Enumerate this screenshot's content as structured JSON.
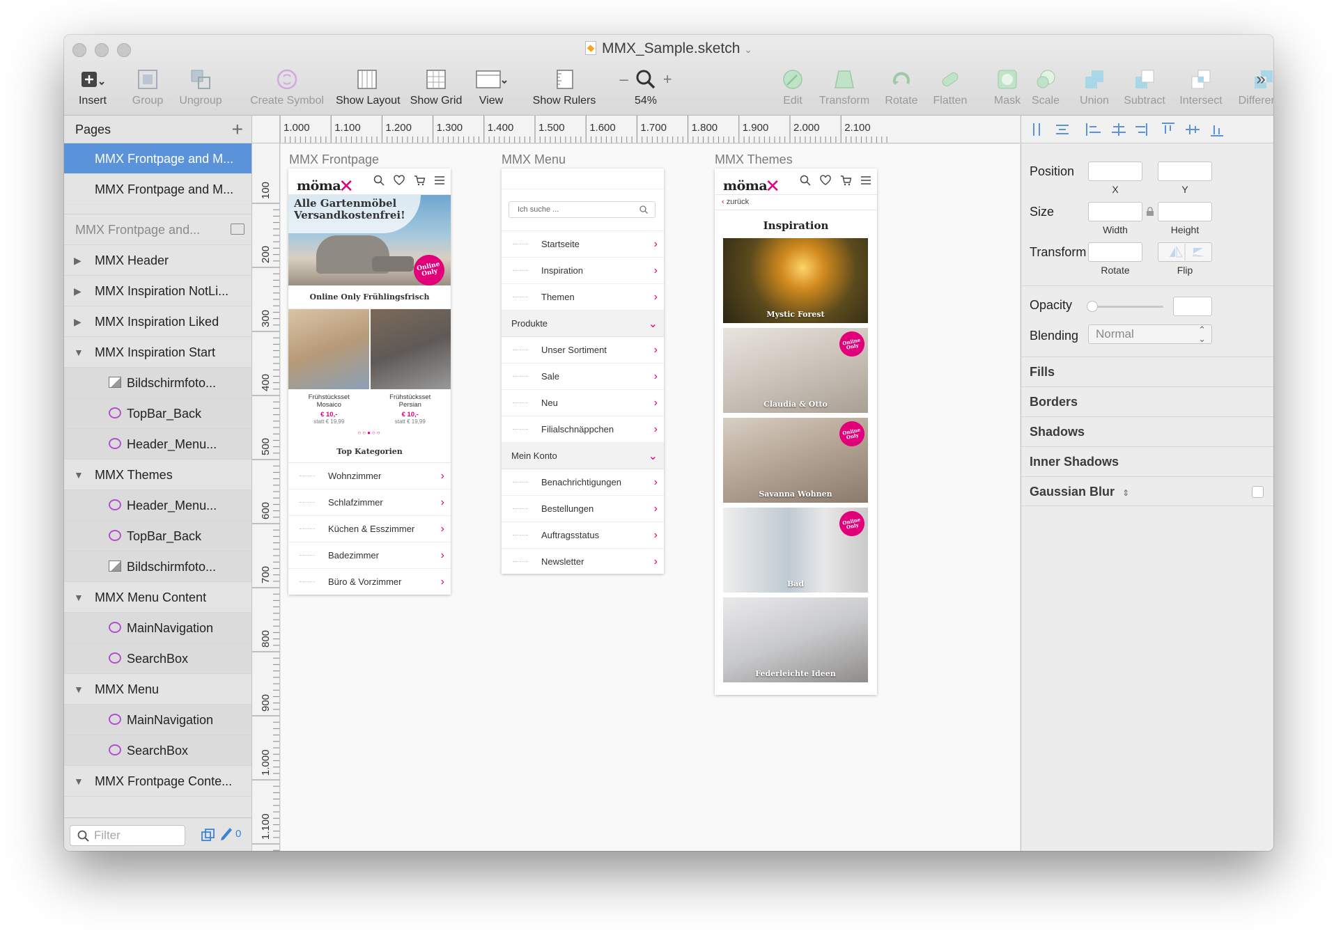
{
  "window": {
    "title": "MMX_Sample.sketch"
  },
  "toolbar": {
    "insert": "Insert",
    "group": "Group",
    "ungroup": "Ungroup",
    "create_symbol": "Create Symbol",
    "show_layout": "Show Layout",
    "show_grid": "Show Grid",
    "view": "View",
    "show_rulers": "Show Rulers",
    "zoom": "54%",
    "zoom_minus": "–",
    "zoom_plus": "+",
    "edit": "Edit",
    "transform": "Transform",
    "rotate": "Rotate",
    "flatten": "Flatten",
    "mask": "Mask",
    "scale": "Scale",
    "union": "Union",
    "subtract": "Subtract",
    "intersect": "Intersect",
    "difference": "Difference",
    "more": "»"
  },
  "sidebar": {
    "pages_title": "Pages",
    "pages": [
      "MMX Frontpage and M...",
      "MMX Frontpage and M..."
    ],
    "layers_title": "MMX Frontpage and...",
    "layers": [
      {
        "label": "MMX Header",
        "level": 0,
        "toggle": "closed"
      },
      {
        "label": "MMX Inspiration NotLi...",
        "level": 0,
        "toggle": "closed"
      },
      {
        "label": "MMX Inspiration Liked",
        "level": 0,
        "toggle": "closed"
      },
      {
        "label": "MMX Inspiration Start",
        "level": 0,
        "toggle": "open"
      },
      {
        "label": "Bildschirmfoto...",
        "level": 1,
        "icon": "image"
      },
      {
        "label": "TopBar_Back",
        "level": 1,
        "icon": "symbol"
      },
      {
        "label": "Header_Menu...",
        "level": 1,
        "icon": "symbol"
      },
      {
        "label": "MMX Themes",
        "level": 0,
        "toggle": "open"
      },
      {
        "label": "Header_Menu...",
        "level": 1,
        "icon": "symbol"
      },
      {
        "label": "TopBar_Back",
        "level": 1,
        "icon": "symbol"
      },
      {
        "label": "Bildschirmfoto...",
        "level": 1,
        "icon": "image"
      },
      {
        "label": "MMX Menu Content",
        "level": 0,
        "toggle": "open"
      },
      {
        "label": "MainNavigation",
        "level": 1,
        "icon": "symbol"
      },
      {
        "label": "SearchBox",
        "level": 1,
        "icon": "symbol"
      },
      {
        "label": "MMX Menu",
        "level": 0,
        "toggle": "open"
      },
      {
        "label": "MainNavigation",
        "level": 1,
        "icon": "symbol"
      },
      {
        "label": "SearchBox",
        "level": 1,
        "icon": "symbol"
      },
      {
        "label": "MMX Frontpage Conte...",
        "level": 0,
        "toggle": "open"
      }
    ],
    "filter_placeholder": "Filter",
    "filter_count": "0"
  },
  "rulers": {
    "top": [
      "1.000",
      "1.100",
      "1.200",
      "1.300",
      "1.400",
      "1.500",
      "1.600",
      "1.700",
      "1.800",
      "1.900",
      "2.000",
      "2.100"
    ],
    "left": [
      "100",
      "200",
      "300",
      "400",
      "500",
      "600",
      "700",
      "800",
      "900",
      "1.000",
      "1.100"
    ]
  },
  "artboards": {
    "frontpage": {
      "label": "MMX Frontpage",
      "logo": "möma",
      "hero_title": "Alle Gartenmöbel Versandkostenfrei!",
      "hero_badge": "Online Only",
      "hero_caption": "Online Only Frühlingsfrisch",
      "products": [
        {
          "name": "Frühstücksset Mosaico",
          "price": "€ 10,-",
          "old": "statt € 19,99"
        },
        {
          "name": "Frühstücksset Persian",
          "price": "€ 10,-",
          "old": "statt € 19,99"
        }
      ],
      "categories_title": "Top Kategorien",
      "categories": [
        "Wohnzimmer",
        "Schlafzimmer",
        "Küchen & Esszimmer",
        "Badezimmer",
        "Büro & Vorzimmer"
      ]
    },
    "menu": {
      "label": "MMX Menu",
      "search_placeholder": "Ich suche ...",
      "items_top": [
        "Startseite",
        "Inspiration",
        "Themen"
      ],
      "section_products": "Produkte",
      "items_products": [
        "Unser Sortiment",
        "Sale",
        "Neu",
        "Filialschnäppchen"
      ],
      "section_account": "Mein Konto",
      "items_account": [
        "Benachrichtigungen",
        "Bestellungen",
        "Auftragsstatus",
        "Newsletter"
      ]
    },
    "themes": {
      "label": "MMX Themes",
      "logo": "möma",
      "back": "zurück",
      "title": "Inspiration",
      "badge": "Online Only",
      "cards": [
        "Mystic Forest",
        "Claudia & Otto",
        "Savanna Wohnen",
        "Bad",
        "Federleichte Ideen"
      ]
    }
  },
  "inspector": {
    "position": "Position",
    "x": "X",
    "y": "Y",
    "size": "Size",
    "width": "Width",
    "height": "Height",
    "transform": "Transform",
    "rotate": "Rotate",
    "flip": "Flip",
    "opacity": "Opacity",
    "blending": "Blending",
    "blending_value": "Normal",
    "sections": [
      "Fills",
      "Borders",
      "Shadows",
      "Inner Shadows",
      "Gaussian Blur"
    ]
  },
  "colors": {
    "accent": "#e2007a",
    "selection": "#5b93db"
  }
}
